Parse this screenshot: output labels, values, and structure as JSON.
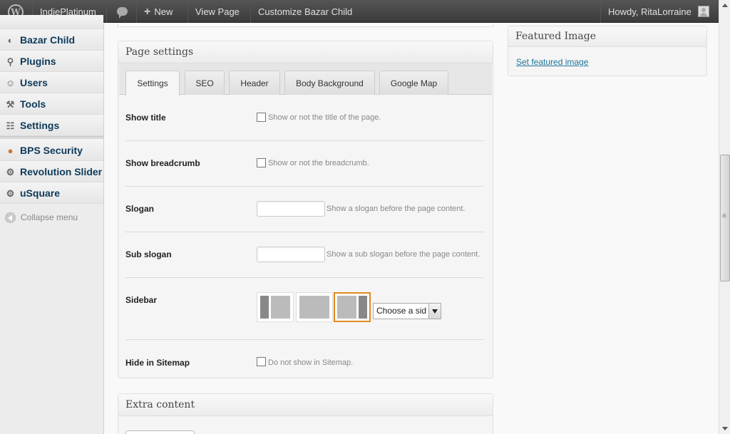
{
  "adminbar": {
    "site_name": "IndiePlatinum",
    "new_label": "New",
    "new_icon": "plus-icon",
    "view_page": "View Page",
    "customize": "Customize Bazar Child",
    "howdy": "Howdy, RitaLorraine"
  },
  "sidebar": {
    "items": [
      {
        "label": "Bazar Child",
        "icon": "bazar-icon"
      },
      {
        "label": "Plugins",
        "icon": "plugin-icon"
      },
      {
        "label": "Users",
        "icon": "users-icon"
      },
      {
        "label": "Tools",
        "icon": "tools-icon"
      },
      {
        "label": "Settings",
        "icon": "settings-icon"
      },
      {
        "label": "BPS Security",
        "icon": "shield-icon"
      },
      {
        "label": "Revolution Slider",
        "icon": "gear-icon"
      },
      {
        "label": "uSquare",
        "icon": "gear-icon"
      }
    ],
    "collapse": "Collapse menu"
  },
  "page_settings": {
    "title": "Page settings",
    "tabs": [
      "Settings",
      "SEO",
      "Header",
      "Body Background",
      "Google Map"
    ],
    "active_tab": "Settings",
    "rows": {
      "show_title": {
        "label": "Show title",
        "desc": "Show or not the title of the page."
      },
      "show_breadcrumb": {
        "label": "Show breadcrumb",
        "desc": "Show or not the breadcrumb."
      },
      "slogan": {
        "label": "Slogan",
        "desc": "Show a slogan before the page content.",
        "value": ""
      },
      "sub_slogan": {
        "label": "Sub slogan",
        "desc": "Show a sub slogan before the page content.",
        "value": ""
      },
      "sidebar": {
        "label": "Sidebar",
        "select_value": "Choose a sid",
        "selected_layout": "sidebar-right"
      },
      "hide_sitemap": {
        "label": "Hide in Sitemap",
        "desc": "Do not show in Sitemap."
      }
    }
  },
  "extra_content": {
    "title": "Extra content"
  },
  "featured_image": {
    "title": "Featured Image",
    "link": "Set featured image"
  },
  "colors": {
    "accent": "#e08a1e",
    "link": "#21759b",
    "adminbar": "#464646"
  }
}
